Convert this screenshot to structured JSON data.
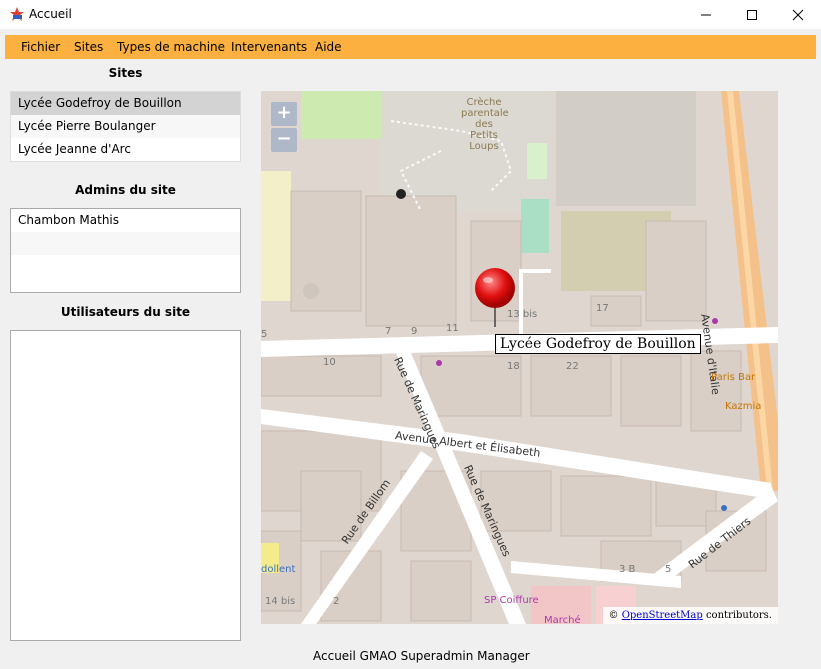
{
  "window": {
    "title": "Accueil"
  },
  "menu": [
    "Fichier",
    "Sites",
    "Types de machine",
    "Intervenants",
    "Aide"
  ],
  "sites": {
    "heading": "Sites",
    "items": [
      "Lycée Godefroy de Bouillon",
      "Lycée Pierre Boulanger",
      "Lycée Jeanne d'Arc"
    ],
    "selected_index": 0
  },
  "admins": {
    "heading": "Admins du site",
    "items": [
      "Chambon Mathis"
    ]
  },
  "users": {
    "heading": "Utilisateurs du site",
    "items": []
  },
  "map": {
    "marker_label": "Lycée Godefroy de Bouillon",
    "zoom_in": "+",
    "zoom_out": "−",
    "attribution_prefix": "© ",
    "attribution_link": "OpenStreetMap",
    "attribution_suffix": " contributors.",
    "labels": {
      "creche": [
        "Crèche",
        "parentale",
        "des Petits",
        "Loups"
      ],
      "avenue_italie": "Avenue d'Italie",
      "avenue_albert": "Avenue Albert et Élisabeth",
      "rue_maringues_1": "Rue de Maringues",
      "rue_maringues_2": "Rue de Maringues",
      "rue_billom": "Rue de Billom",
      "rue_thiers": "Rue de Thiers",
      "paris_bar": "Paris Bar",
      "kazmia": "Kazmia",
      "sp_coiffure": "SP Coiffure",
      "dollent": "dollent",
      "marche": "Marché",
      "n17": "17",
      "n13bis": "13 bis",
      "n7": "7",
      "n9": "9",
      "n11": "11",
      "n5": "5",
      "n10": "10",
      "n18": "18",
      "n22": "22",
      "n3b": "3 B",
      "n5b": "5",
      "n14bis": "14 bis",
      "n2": "2"
    }
  },
  "status": "Accueil GMAO Superadmin Manager"
}
